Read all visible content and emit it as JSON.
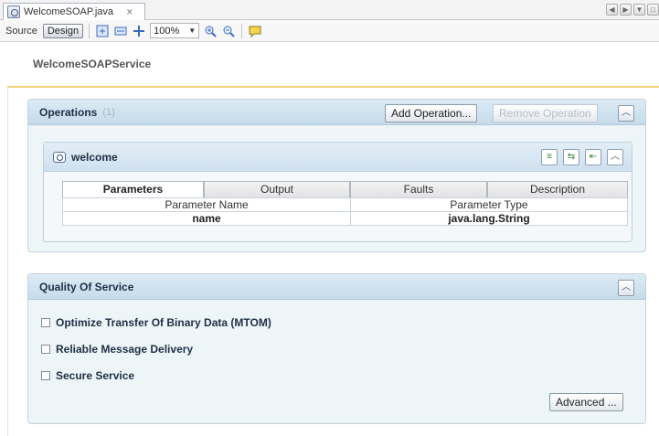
{
  "tab": {
    "filename": "WelcomeSOAP.java",
    "close": "✕"
  },
  "toolbar": {
    "source_label": "Source",
    "design_label": "Design",
    "zoom": "100%"
  },
  "service": {
    "title": "WelcomeSOAPService"
  },
  "operations": {
    "title": "Operations",
    "count": "(1)",
    "add_button": "Add Operation...",
    "remove_button": "Remove Operation",
    "operation": {
      "name": "welcome",
      "tabs": [
        "Parameters",
        "Output",
        "Faults",
        "Description"
      ],
      "columns": [
        "Parameter Name",
        "Parameter Type"
      ],
      "rows": [
        {
          "name": "name",
          "type": "java.lang.String"
        }
      ]
    }
  },
  "qos": {
    "title": "Quality Of Service",
    "options": [
      "Optimize Transfer Of Binary Data (MTOM)",
      "Reliable Message Delivery",
      "Secure Service"
    ],
    "advanced_button": "Advanced ..."
  },
  "icons": {
    "file": "web-service-icon",
    "operation": "operation-icon",
    "zoom_in": "zoom-in-icon",
    "zoom_out": "zoom-out-icon"
  },
  "colors": {
    "panel_bg": "#eef5f9",
    "header_accent": "#f1d27a"
  }
}
